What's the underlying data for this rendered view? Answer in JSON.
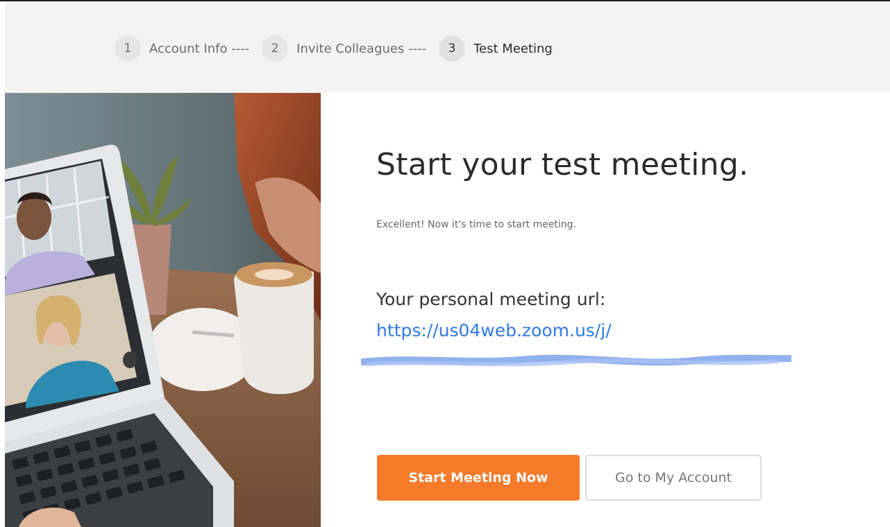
{
  "steps": [
    {
      "number": "1",
      "label": "Account Info ----"
    },
    {
      "number": "2",
      "label": "Invite Colleagues ----"
    },
    {
      "number": "3",
      "label": "Test Meeting"
    }
  ],
  "main": {
    "title": "Start your test meeting.",
    "subtitle": "Excellent! Now it's time to start meeting.",
    "url_label": "Your personal meeting url:",
    "url": "https://us04web.zoom.us/j/"
  },
  "buttons": {
    "start": "Start Meeting Now",
    "account": "Go to My Account"
  },
  "colors": {
    "accent": "#f57b2a",
    "link": "#2f7be5",
    "stepbar_bg": "#f3f3f3"
  }
}
